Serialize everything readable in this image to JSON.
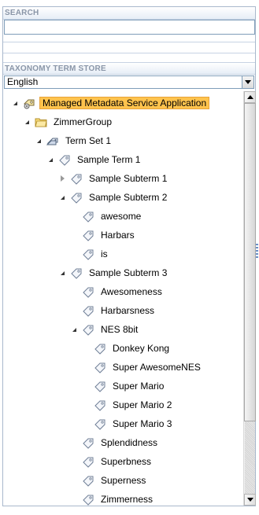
{
  "search": {
    "header": "SEARCH",
    "value": ""
  },
  "term_store": {
    "header": "TAXONOMY TERM STORE",
    "language": "English"
  },
  "tree": [
    {
      "label": "Managed Metadata Service Application",
      "depth": 0,
      "toggle": "expanded",
      "icon": "service-application-icon",
      "selected": true
    },
    {
      "label": "ZimmerGroup",
      "depth": 1,
      "toggle": "expanded",
      "icon": "folder-icon"
    },
    {
      "label": "Term Set 1",
      "depth": 2,
      "toggle": "expanded",
      "icon": "term-set-icon"
    },
    {
      "label": "Sample Term 1",
      "depth": 3,
      "toggle": "expanded",
      "icon": "tag-icon"
    },
    {
      "label": "Sample Subterm 1",
      "depth": 4,
      "toggle": "collapsed",
      "icon": "tag-icon"
    },
    {
      "label": "Sample Subterm 2",
      "depth": 4,
      "toggle": "expanded",
      "icon": "tag-icon"
    },
    {
      "label": "awesome",
      "depth": 5,
      "toggle": "none",
      "icon": "tag-icon"
    },
    {
      "label": "Harbars",
      "depth": 5,
      "toggle": "none",
      "icon": "tag-icon"
    },
    {
      "label": "is",
      "depth": 5,
      "toggle": "none",
      "icon": "tag-icon"
    },
    {
      "label": "Sample Subterm 3",
      "depth": 4,
      "toggle": "expanded",
      "icon": "tag-icon"
    },
    {
      "label": "Awesomeness",
      "depth": 5,
      "toggle": "none",
      "icon": "tag-icon"
    },
    {
      "label": "Harbarsness",
      "depth": 5,
      "toggle": "none",
      "icon": "tag-icon"
    },
    {
      "label": "NES 8bit",
      "depth": 5,
      "toggle": "expanded",
      "icon": "tag-icon"
    },
    {
      "label": "Donkey Kong",
      "depth": 6,
      "toggle": "none",
      "icon": "tag-icon"
    },
    {
      "label": "Super AwesomeNES",
      "depth": 6,
      "toggle": "none",
      "icon": "tag-icon"
    },
    {
      "label": "Super Mario",
      "depth": 6,
      "toggle": "none",
      "icon": "tag-icon"
    },
    {
      "label": "Super Mario 2",
      "depth": 6,
      "toggle": "none",
      "icon": "tag-icon"
    },
    {
      "label": "Super Mario 3",
      "depth": 6,
      "toggle": "none",
      "icon": "tag-icon"
    },
    {
      "label": "Splendidness",
      "depth": 5,
      "toggle": "none",
      "icon": "tag-icon"
    },
    {
      "label": "Superbness",
      "depth": 5,
      "toggle": "none",
      "icon": "tag-icon"
    },
    {
      "label": "Superness",
      "depth": 5,
      "toggle": "none",
      "icon": "tag-icon"
    },
    {
      "label": "Zimmerness",
      "depth": 5,
      "toggle": "none",
      "icon": "tag-icon"
    }
  ]
}
